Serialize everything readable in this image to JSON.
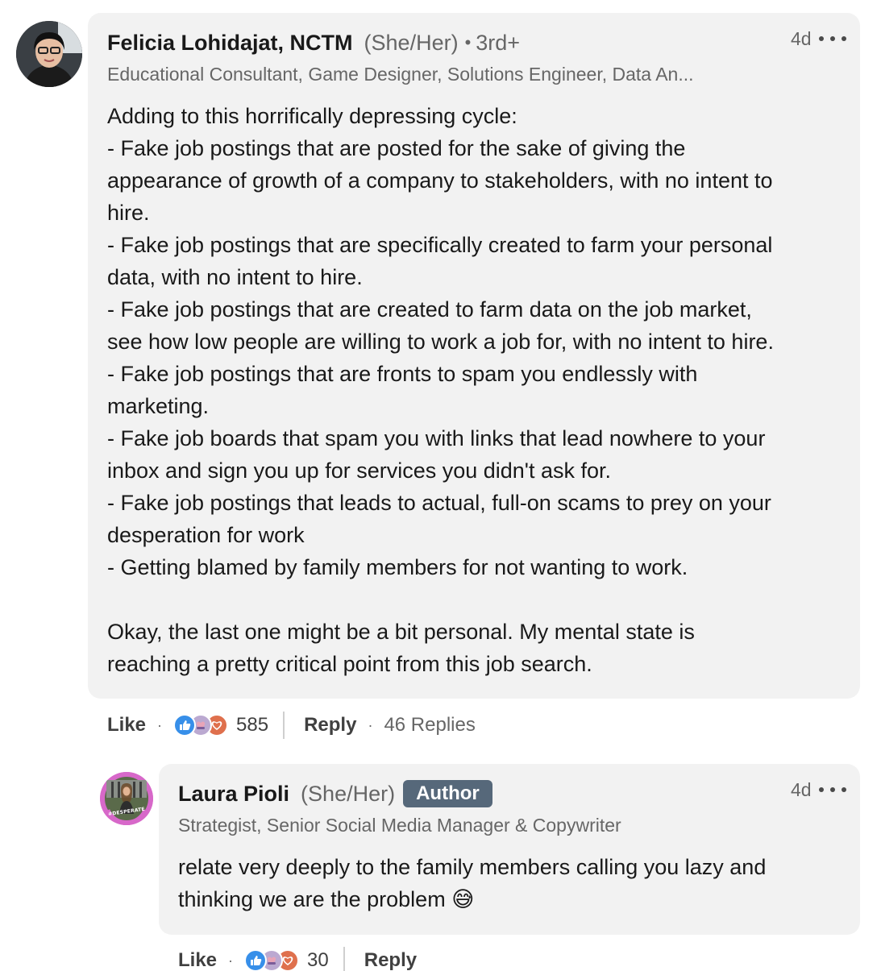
{
  "comments": [
    {
      "author": "Felicia Lohidajat, NCTM",
      "pronouns": "(She/Her)",
      "degree": "3rd+",
      "headline": "Educational Consultant, Game Designer, Solutions Engineer, Data An...",
      "time": "4d",
      "body": [
        "Adding to this horrifically depressing cycle:",
        "- Fake job postings that are posted for the sake of giving the",
        "appearance of growth of a company to stakeholders, with no intent to",
        "hire.",
        "- Fake job postings that are specifically created to farm your personal",
        "data, with no intent to hire.",
        "- Fake job postings that are created to farm data on the job market,",
        "see how low people are willing to work a job for, with no intent to hire.",
        "- Fake job postings that are fronts to spam you endlessly with",
        "marketing.",
        "- Fake job boards that spam you with links that lead nowhere to your",
        "inbox and sign you up for services you didn't ask for.",
        "- Fake job postings that leads to actual, full-on scams to prey on your",
        "desperation for work",
        "- Getting blamed by family members for not wanting to work.",
        "",
        "Okay, the last one might be a bit personal. My mental state is",
        "reaching a pretty critical point from this job search."
      ],
      "like_label": "Like",
      "reaction_count": "585",
      "reply_label": "Reply",
      "replies_label": "46 Replies",
      "reaction_icons": [
        "like-icon",
        "support-icon",
        "love-icon"
      ]
    },
    {
      "author": "Laura Pioli",
      "pronouns": "(She/Her)",
      "badge": "Author",
      "headline": "Strategist, Senior Social Media Manager & Copywriter",
      "time": "4d",
      "avatar_ring_text": "#DESPERATE",
      "body": [
        "relate very deeply to the family members calling you lazy and",
        "thinking we are the problem 😅"
      ],
      "like_label": "Like",
      "reaction_count": "30",
      "reply_label": "Reply",
      "reaction_icons": [
        "like-icon",
        "support-icon",
        "love-icon"
      ]
    }
  ],
  "colors": {
    "bubble_bg": "#f2f2f2",
    "badge_bg": "#56687a",
    "like_blue": "#378fe9",
    "support_purple": "#bba9d1",
    "love_red": "#df704d",
    "ring_pink": "#d768c9"
  }
}
